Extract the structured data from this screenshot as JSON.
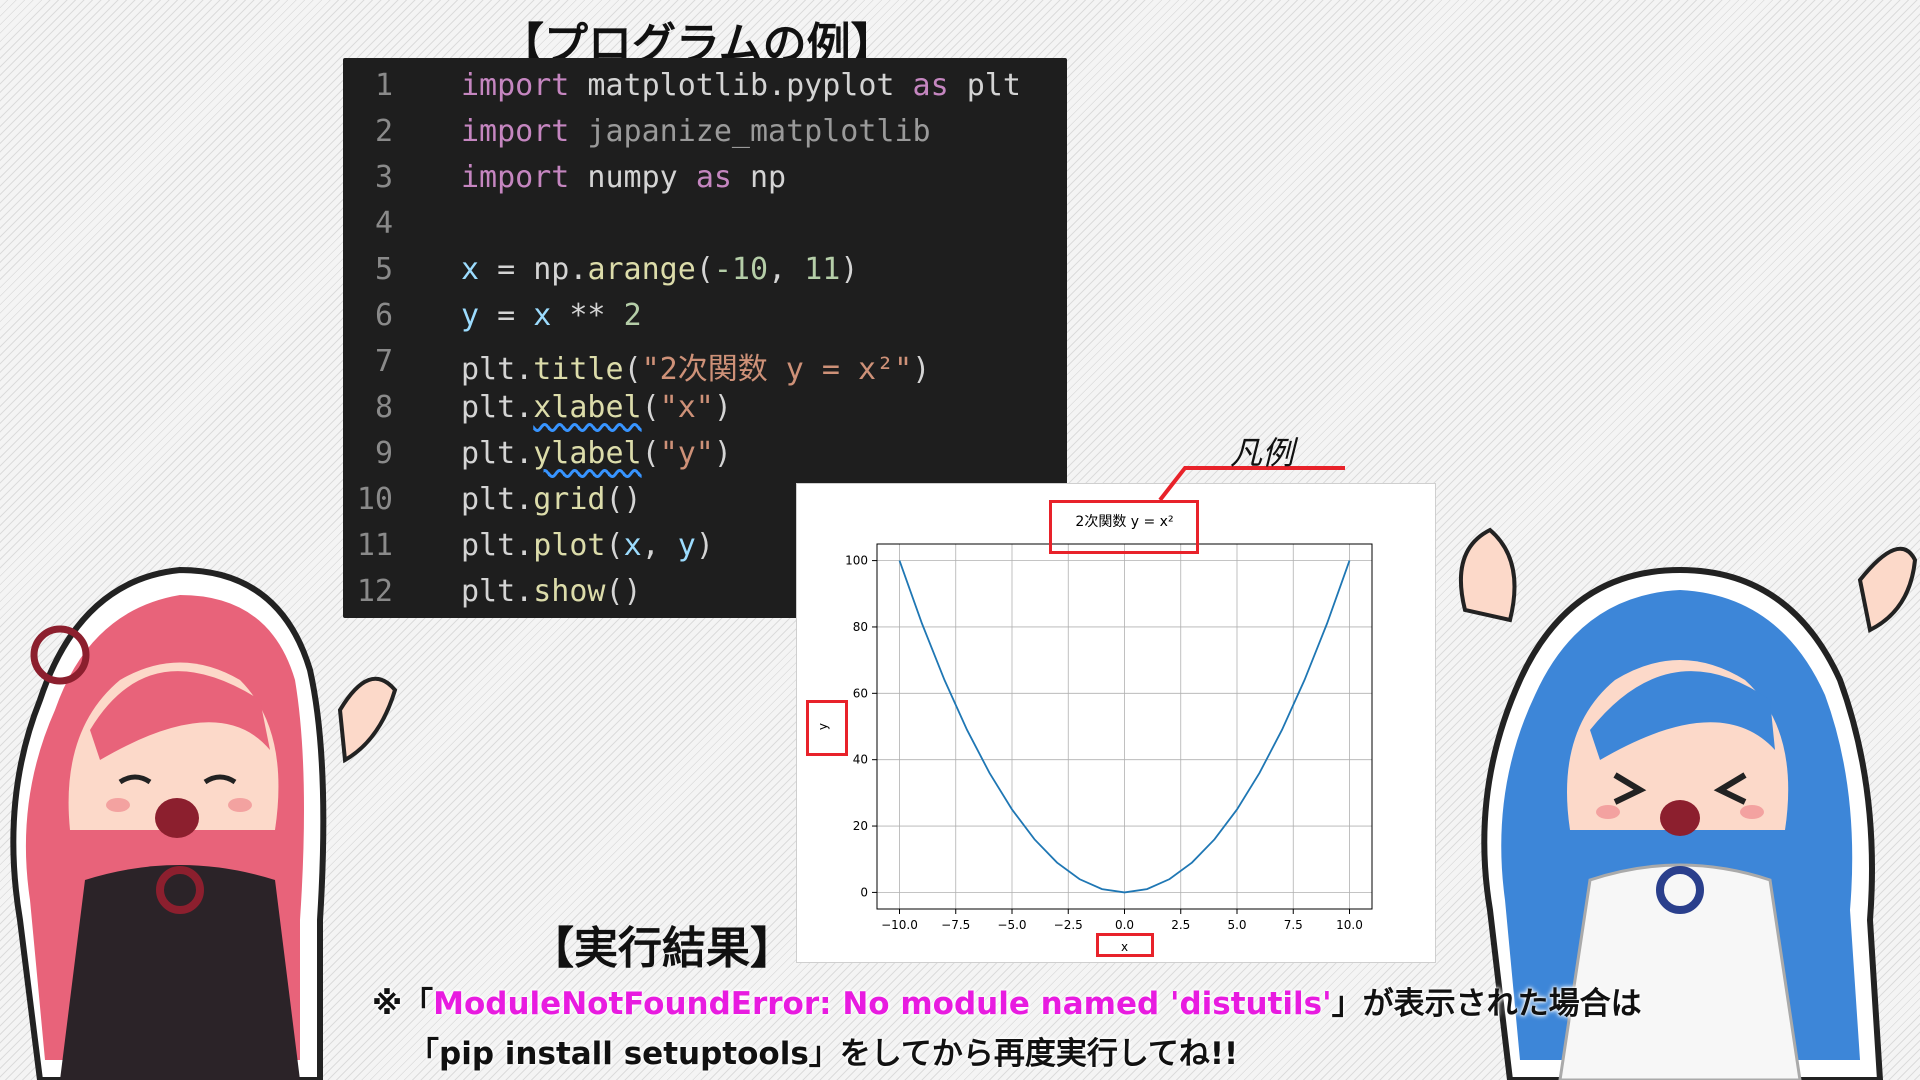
{
  "headings": {
    "program": "【プログラムの例】",
    "result": "【実行結果】",
    "legend_callout": "凡例"
  },
  "code": [
    {
      "no": "1",
      "parts": [
        [
          "kw",
          "import"
        ],
        [
          "plain",
          " matplotlib.pyplot "
        ],
        [
          "kw",
          "as"
        ],
        [
          "plain",
          " plt"
        ]
      ]
    },
    {
      "no": "2",
      "parts": [
        [
          "kw",
          "import"
        ],
        [
          "dim",
          " japanize_matplotlib"
        ]
      ]
    },
    {
      "no": "3",
      "parts": [
        [
          "kw",
          "import"
        ],
        [
          "plain",
          " numpy "
        ],
        [
          "kw",
          "as"
        ],
        [
          "plain",
          " np"
        ]
      ]
    },
    {
      "no": "4",
      "parts": []
    },
    {
      "no": "5",
      "parts": [
        [
          "var",
          "x"
        ],
        [
          "plain",
          " = np."
        ],
        [
          "fn",
          "arange"
        ],
        [
          "plain",
          "("
        ],
        [
          "num",
          "-10"
        ],
        [
          "plain",
          ", "
        ],
        [
          "num",
          "11"
        ],
        [
          "plain",
          ")"
        ]
      ]
    },
    {
      "no": "6",
      "parts": [
        [
          "var",
          "y"
        ],
        [
          "plain",
          " = "
        ],
        [
          "var",
          "x"
        ],
        [
          "plain",
          " ** "
        ],
        [
          "num",
          "2"
        ]
      ]
    },
    {
      "no": "7",
      "parts": [
        [
          "plain",
          "plt."
        ],
        [
          "fn",
          "title"
        ],
        [
          "plain",
          "("
        ],
        [
          "str",
          "\"2次関数 y = x²\""
        ],
        [
          "plain",
          ")"
        ]
      ]
    },
    {
      "no": "8",
      "parts": [
        [
          "plain",
          "plt."
        ],
        [
          "fn squiggle",
          "xlabel"
        ],
        [
          "plain",
          "("
        ],
        [
          "str",
          "\"x\""
        ],
        [
          "plain",
          ")"
        ]
      ]
    },
    {
      "no": "9",
      "parts": [
        [
          "plain",
          "plt."
        ],
        [
          "fn squiggle",
          "ylabel"
        ],
        [
          "plain",
          "("
        ],
        [
          "str",
          "\"y\""
        ],
        [
          "plain",
          ")"
        ]
      ]
    },
    {
      "no": "10",
      "parts": [
        [
          "plain",
          "plt."
        ],
        [
          "fn",
          "grid"
        ],
        [
          "plain",
          "()"
        ]
      ]
    },
    {
      "no": "11",
      "parts": [
        [
          "plain",
          "plt."
        ],
        [
          "fn",
          "plot"
        ],
        [
          "plain",
          "("
        ],
        [
          "var",
          "x"
        ],
        [
          "plain",
          ", "
        ],
        [
          "var",
          "y"
        ],
        [
          "plain",
          ")"
        ]
      ]
    },
    {
      "no": "12",
      "parts": [
        [
          "plain",
          "plt."
        ],
        [
          "fn",
          "show"
        ],
        [
          "plain",
          "()"
        ]
      ]
    }
  ],
  "chart_data": {
    "type": "line",
    "title": "2次関数 y = x²",
    "xlabel": "x",
    "ylabel": "y",
    "x": [
      -10,
      -9,
      -8,
      -7,
      -6,
      -5,
      -4,
      -3,
      -2,
      -1,
      0,
      1,
      2,
      3,
      4,
      5,
      6,
      7,
      8,
      9,
      10
    ],
    "series": [
      {
        "values": [
          100,
          81,
          64,
          49,
          36,
          25,
          16,
          9,
          4,
          1,
          0,
          1,
          4,
          9,
          16,
          25,
          36,
          49,
          64,
          81,
          100
        ],
        "color": "#1f77b4"
      }
    ],
    "xticks": [
      "−10.0",
      "−7.5",
      "−5.0",
      "−2.5",
      "0.0",
      "2.5",
      "5.0",
      "7.5",
      "10.0"
    ],
    "xtick_values": [
      -10,
      -7.5,
      -5,
      -2.5,
      0,
      2.5,
      5,
      7.5,
      10
    ],
    "yticks": [
      "0",
      "20",
      "40",
      "60",
      "80",
      "100"
    ],
    "ytick_values": [
      0,
      20,
      40,
      60,
      80,
      100
    ],
    "xlim": [
      -11,
      11
    ],
    "ylim": [
      -5,
      105
    ],
    "grid": true
  },
  "note": {
    "line1_prefix": "※「",
    "line1_error": "ModuleNotFoundError: No module named 'distutils'",
    "line1_suffix": "」が表示された場合は",
    "line2": "「pip install setuptools」をしてから再度実行してね!!"
  },
  "colors": {
    "highlight_box": "#e8222a",
    "error_text": "#e81be0",
    "code_bg": "#1e1e1e",
    "left_character_hair": "#e8637a",
    "right_character_hair": "#3d86d8"
  }
}
